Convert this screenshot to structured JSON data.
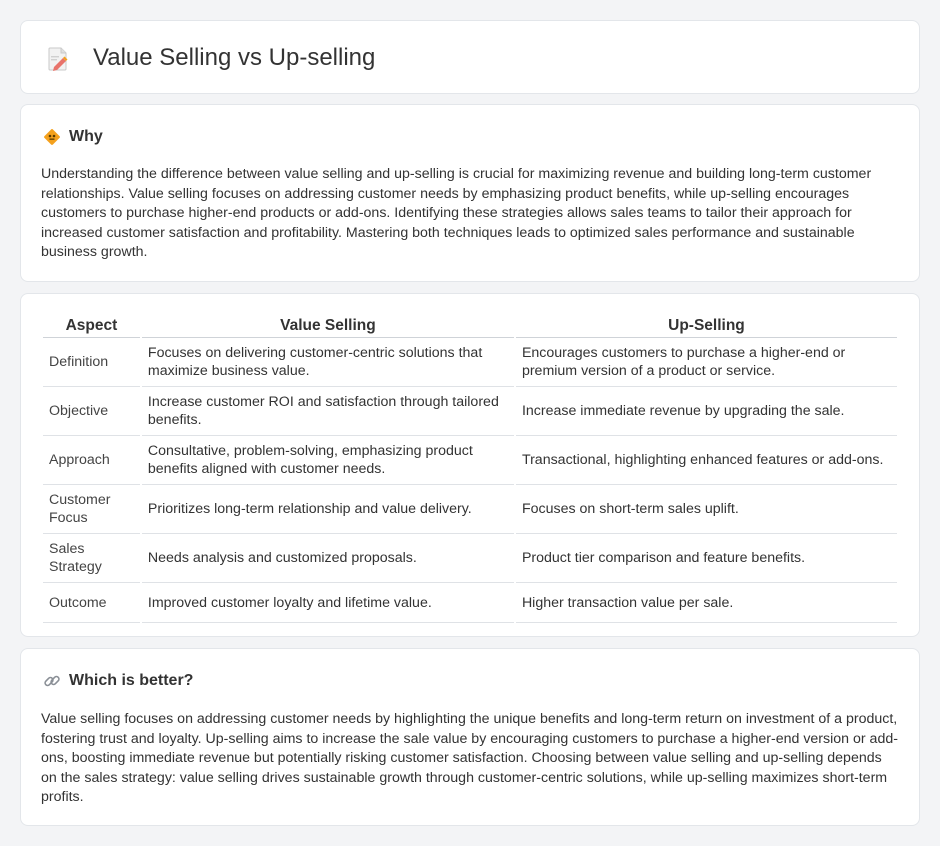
{
  "header": {
    "title": "Value Selling vs Up-selling",
    "icon": "document-pencil-icon"
  },
  "why": {
    "icon": "diamond-sign-icon",
    "heading": "Why",
    "text": "Understanding the difference between value selling and up-selling is crucial for maximizing revenue and building long-term customer relationships. Value selling focuses on addressing customer needs by emphasizing product benefits, while up-selling encourages customers to purchase higher-end products or add-ons. Identifying these strategies allows sales teams to tailor their approach for increased customer satisfaction and profitability. Mastering both techniques leads to optimized sales performance and sustainable business growth."
  },
  "table": {
    "headers": [
      "Aspect",
      "Value Selling",
      "Up-Selling"
    ],
    "rows": [
      [
        "Definition",
        "Focuses on delivering customer-centric solutions that maximize business value.",
        "Encourages customers to purchase a higher-end or premium version of a product or service."
      ],
      [
        "Objective",
        "Increase customer ROI and satisfaction through tailored benefits.",
        "Increase immediate revenue by upgrading the sale."
      ],
      [
        "Approach",
        "Consultative, problem-solving, emphasizing product benefits aligned with customer needs.",
        "Transactional, highlighting enhanced features or add-ons."
      ],
      [
        "Customer Focus",
        "Prioritizes long-term relationship and value delivery.",
        "Focuses on short-term sales uplift."
      ],
      [
        "Sales Strategy",
        "Needs analysis and customized proposals.",
        "Product tier comparison and feature benefits."
      ],
      [
        "Outcome",
        "Improved customer loyalty and lifetime value.",
        "Higher transaction value per sale."
      ]
    ]
  },
  "which": {
    "icon": "link-icon",
    "heading": "Which is better?",
    "text": "Value selling focuses on addressing customer needs by highlighting the unique benefits and long-term return on investment of a product, fostering trust and loyalty. Up-selling aims to increase the sale value by encouraging customers to purchase a higher-end version or add-ons, boosting immediate revenue but potentially risking customer satisfaction. Choosing between value selling and up-selling depends on the sales strategy: value selling drives sustainable growth through customer-centric solutions, while up-selling maximizes short-term profits."
  },
  "colors": {
    "page_bg": "#f3f4f6",
    "card_bg": "#ffffff",
    "text": "#333333",
    "icon_orange": "#f4a11d",
    "icon_pink": "#e8736b"
  }
}
